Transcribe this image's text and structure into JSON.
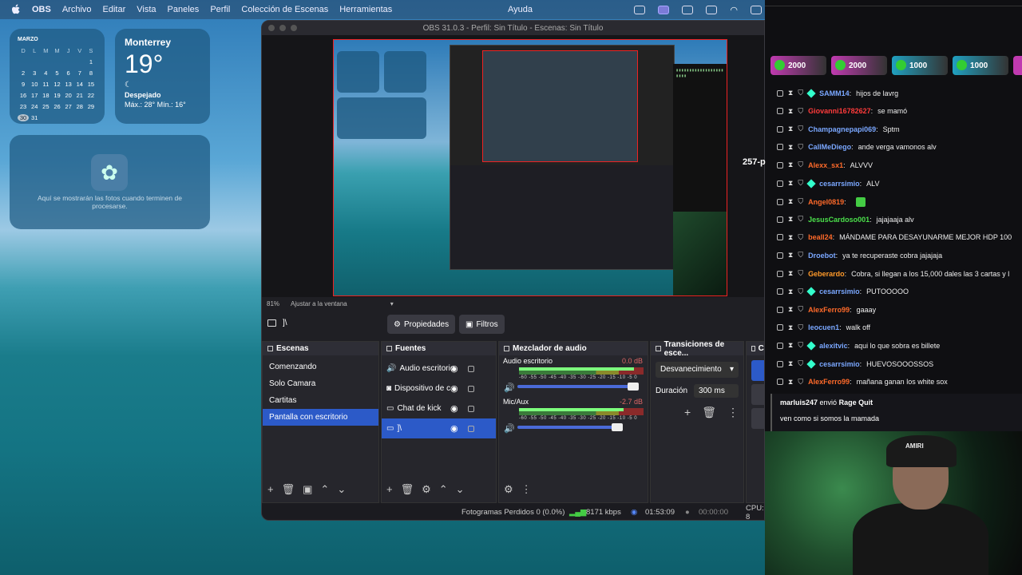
{
  "menubar": {
    "app": "OBS",
    "items": [
      "Archivo",
      "Editar",
      "Vista",
      "Paneles",
      "Perfil",
      "Colección de Escenas",
      "Herramientas"
    ],
    "help": "Ayuda"
  },
  "calendar": {
    "month": "MARZO",
    "days_header": [
      "D",
      "L",
      "M",
      "M",
      "J",
      "V",
      "S"
    ],
    "dates": [
      "",
      "",
      "",
      "",
      "",
      "",
      "1",
      "2",
      "3",
      "4",
      "5",
      "6",
      "7",
      "8",
      "9",
      "10",
      "11",
      "12",
      "13",
      "14",
      "15",
      "16",
      "17",
      "18",
      "19",
      "20",
      "21",
      "22",
      "23",
      "24",
      "25",
      "26",
      "27",
      "28",
      "29",
      "30",
      "31"
    ],
    "today": "30"
  },
  "weather": {
    "city": "Monterrey",
    "temp": "19°",
    "condition": "Despejado",
    "hilo": "Máx.: 28° Mín.: 16°"
  },
  "photos_widget": {
    "text": "Aquí se mostrarán las fotos cuando terminen de procesarse."
  },
  "obs": {
    "title": "OBS 31.0.3 - Perfil: Sin Título - Escenas: Sin Título",
    "zoom": "81%",
    "fit": "Ajustar a la ventana",
    "selected_source": "]\\",
    "properties_btn": "Propiedades",
    "filters_btn": "Filtros",
    "docks": {
      "scenes_title": "Escenas",
      "sources_title": "Fuentes",
      "mixer_title": "Mezclador de audio",
      "transitions_title": "Transiciones de esce...",
      "controls_title": "Co"
    },
    "scenes": [
      "Comenzando",
      "Solo Camara",
      "Cartitas",
      "Pantalla con escritorio"
    ],
    "sources": [
      "Audio escritorio",
      "Dispositivo de c",
      "Chat de kick",
      "]\\"
    ],
    "mixer": [
      {
        "name": "Audio escritorio",
        "db": "0.0 dB",
        "level": 0.92
      },
      {
        "name": "Mic/Aux",
        "db": "-2.7 dB",
        "level": 0.84
      }
    ],
    "ticks": "-60 -55 -50 -45 -40 -35 -30 -25 -20 -15 -10 -5 0",
    "transition": "Desvanecimiento",
    "duration_label": "Duración",
    "duration": "300 ms",
    "status": {
      "dropped": "Fotogramas Perdidos 0 (0.0%)",
      "bitrate": "8171 kbps",
      "live_time": "01:53:09",
      "rec_time": "00:00:00",
      "cpu": "CPU: 8"
    }
  },
  "gifts": [
    {
      "value": "2000",
      "color": "#c03ab0"
    },
    {
      "value": "2000",
      "color": "#c03ab0"
    },
    {
      "value": "1000",
      "color": "#20a0c0"
    },
    {
      "value": "1000",
      "color": "#20a0c0"
    }
  ],
  "chat": [
    {
      "user": "SAMM14",
      "color": "#7aa7ff",
      "msg": "hijos de lavrg",
      "gem": true
    },
    {
      "user": "Giovanni16782627",
      "color": "#ff3b3b",
      "msg": "se mamó",
      "gem": false
    },
    {
      "user": "Champagnepapi069",
      "color": "#7aa7ff",
      "msg": "Sptm",
      "gem": false
    },
    {
      "user": "CallMeDiego",
      "color": "#7aa7ff",
      "msg": "ande verga vamonos alv",
      "gem": false
    },
    {
      "user": "Alexx_sx1",
      "color": "#ff6a2a",
      "msg": "ALVVV",
      "gem": false
    },
    {
      "user": "cesarrsimio",
      "color": "#7aa7ff",
      "msg": "ALV",
      "gem": true
    },
    {
      "user": "Angel0819",
      "color": "#ff6a2a",
      "msg": "",
      "gem": false
    },
    {
      "user": "JesusCardoso001",
      "color": "#4be04b",
      "msg": "jajajaaja alv",
      "gem": false
    },
    {
      "user": "beall24",
      "color": "#ff6a2a",
      "msg": "MÁNDAME PARA DESAYUNARME MEJOR HDP 100",
      "gem": false
    },
    {
      "user": "Droebot",
      "color": "#7aa7ff",
      "msg": "ya te recuperaste cobra jajajaja",
      "gem": false
    },
    {
      "user": "Geberardo",
      "color": "#ff9a2a",
      "msg": "Cobra, si llegan a los 15,000 dales las 3 cartas y l",
      "gem": false
    },
    {
      "user": "cesarrsimio",
      "color": "#7aa7ff",
      "msg": "PUTOOOOO",
      "gem": true
    },
    {
      "user": "AlexFerro99",
      "color": "#ff6a2a",
      "msg": "gaaay",
      "gem": false
    },
    {
      "user": "leocuen1",
      "color": "#7aa7ff",
      "msg": "walk off",
      "gem": false
    },
    {
      "user": "alexitvic",
      "color": "#7aa7ff",
      "msg": "aqui lo que sobra es billete",
      "gem": true
    },
    {
      "user": "cesarrsimio",
      "color": "#7aa7ff",
      "msg": "HUEVOSOOOSSOS",
      "gem": true
    },
    {
      "user": "AlexFerro99",
      "color": "#ff6a2a",
      "msg": "mañana ganan los white sox",
      "gem": false
    }
  ],
  "alert": {
    "user": "marluis247",
    "sent": "envió",
    "gift": "Rage Quit",
    "msg": "ven como si somos la mamada"
  },
  "overlay": {
    "preview_number": "257-p"
  },
  "cam_hat": "AMIRI"
}
